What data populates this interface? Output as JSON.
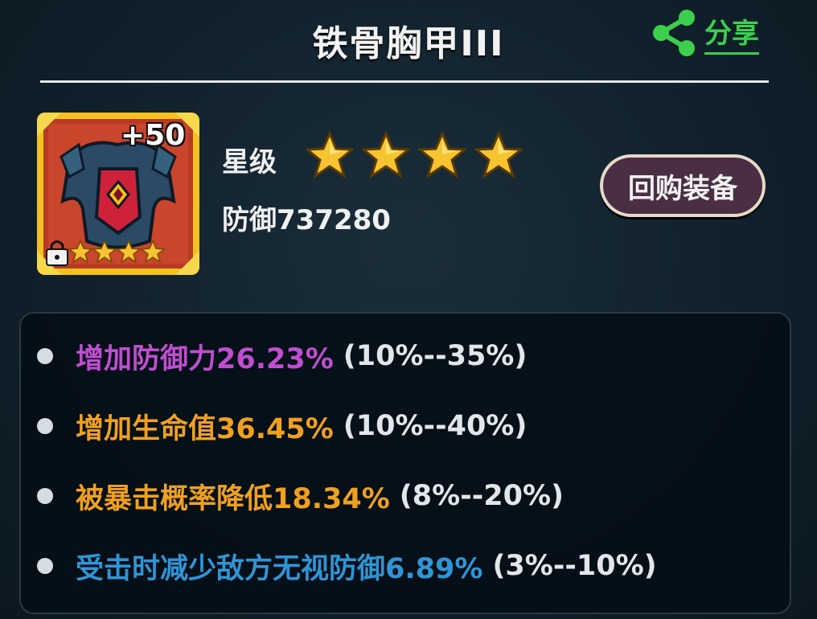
{
  "header": {
    "title": "铁骨胸甲III",
    "share_label": "分享"
  },
  "item": {
    "enhance_level": "+50",
    "icon_stars": 4,
    "star_label": "星级",
    "star_count": 4,
    "defense_text": "防御737280"
  },
  "actions": {
    "buyback_label": "回购装备"
  },
  "attributes": [
    {
      "text": "增加防御力26.23%",
      "range": "(10%--35%)",
      "color": "#c04ed0"
    },
    {
      "text": "增加生命值36.45%",
      "range": "(10%--40%)",
      "color": "#f0a020"
    },
    {
      "text": "被暴击概率降低18.34%",
      "range": "(8%--20%)",
      "color": "#f0a020"
    },
    {
      "text": "受击时减少敌方无视防御6.89%",
      "range": "(3%--10%)",
      "color": "#2f95d6"
    }
  ],
  "colors": {
    "accent_share": "#3ccf4e",
    "star": "#f7c431",
    "buyback_bg": "#4a2f44"
  },
  "icons": {
    "share": "share-icon",
    "star": "star-icon",
    "lock": "lock-icon",
    "armor": "chest-armor-icon"
  }
}
